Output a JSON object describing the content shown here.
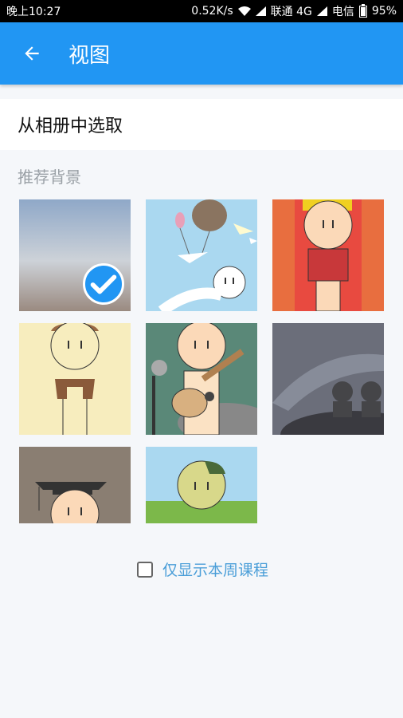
{
  "status_bar": {
    "time": "晚上10:27",
    "speed": "0.52K/s",
    "carrier1": "联通 4G",
    "carrier2": "电信",
    "battery": "95%"
  },
  "appbar": {
    "title": "视图"
  },
  "album": {
    "label": "从相册中选取"
  },
  "recommended": {
    "title": "推荐背景",
    "items": [
      {
        "name": "sky-gradient",
        "selected": true
      },
      {
        "name": "kite-balloon"
      },
      {
        "name": "firecrackers"
      },
      {
        "name": "scarf"
      },
      {
        "name": "guitar"
      },
      {
        "name": "night-sky"
      },
      {
        "name": "graduate"
      },
      {
        "name": "camouflage"
      }
    ]
  },
  "week_only": {
    "label": "仅显示本周课程",
    "checked": false
  },
  "colors": {
    "primary": "#2196f3",
    "link": "#4a9ed8"
  }
}
